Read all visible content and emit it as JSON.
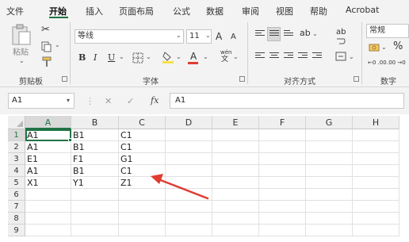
{
  "menu": {
    "items": [
      "文件",
      "开始",
      "插入",
      "页面布局",
      "公式",
      "数据",
      "审阅",
      "视图",
      "帮助",
      "Acrobat"
    ],
    "active_index": 1
  },
  "ribbon": {
    "clipboard": {
      "paste_label": "粘贴",
      "group_label": "剪贴板"
    },
    "font": {
      "font_name": "等线",
      "font_size": "11",
      "grow_label": "A",
      "shrink_label": "A",
      "bold_label": "B",
      "italic_label": "I",
      "underline_label": "U",
      "font_color_label": "A",
      "wen_label": "wén",
      "zi_label": "文",
      "group_label": "字体"
    },
    "alignment": {
      "wrap_label": "ab",
      "group_label": "对齐方式"
    },
    "number": {
      "format_value": "常规",
      "percent_label": "%",
      "decimal_inc": "←0 .00",
      "decimal_dec": ".00 →0",
      "group_label": "数字"
    }
  },
  "formula_bar": {
    "name_box": "A1",
    "cancel_icon": "✕",
    "enter_icon": "✓",
    "fx_label": "fx",
    "formula": "A1"
  },
  "grid": {
    "columns": [
      "A",
      "B",
      "C",
      "D",
      "E",
      "F",
      "G",
      "H"
    ],
    "rows": [
      "1",
      "2",
      "3",
      "4",
      "5",
      "6",
      "7",
      "8",
      "9"
    ],
    "cells": [
      [
        "A1",
        "B1",
        "C1",
        "",
        "",
        "",
        "",
        ""
      ],
      [
        "A1",
        "B1",
        "C1",
        "",
        "",
        "",
        "",
        ""
      ],
      [
        "E1",
        "F1",
        "G1",
        "",
        "",
        "",
        "",
        ""
      ],
      [
        "A1",
        "B1",
        "C1",
        "",
        "",
        "",
        "",
        ""
      ],
      [
        "X1",
        "Y1",
        "Z1",
        "",
        "",
        "",
        "",
        ""
      ],
      [
        "",
        "",
        "",
        "",
        "",
        "",
        "",
        ""
      ],
      [
        "",
        "",
        "",
        "",
        "",
        "",
        "",
        ""
      ],
      [
        "",
        "",
        "",
        "",
        "",
        "",
        "",
        ""
      ],
      [
        "",
        "",
        "",
        "",
        "",
        "",
        "",
        ""
      ]
    ],
    "active_cell": "A1"
  },
  "colors": {
    "accent": "#217346",
    "annotation_arrow": "#e03c31"
  }
}
